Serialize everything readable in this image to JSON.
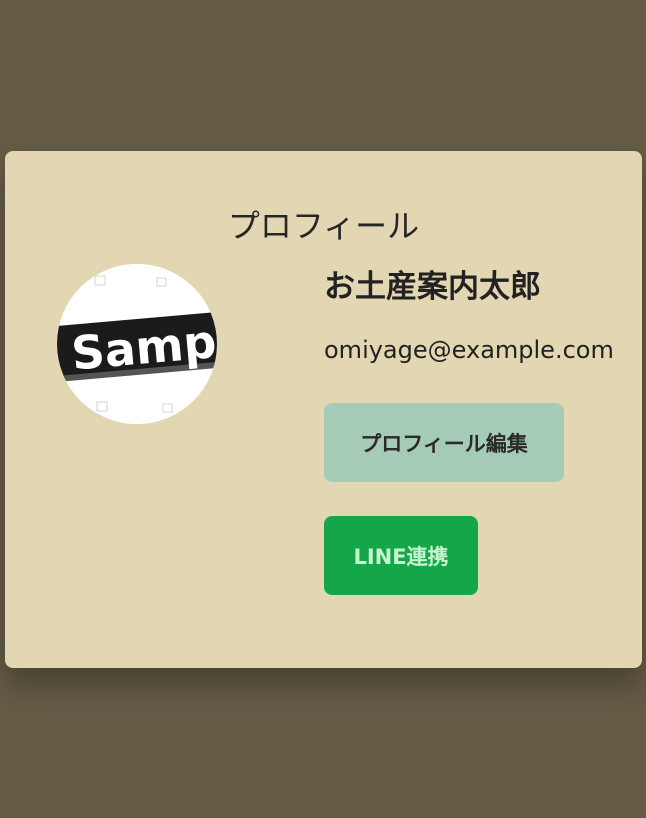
{
  "profile": {
    "heading": "プロフィール",
    "name": "お土産案内太郎",
    "email": "omiyage@example.com",
    "avatar_text": "Sample"
  },
  "actions": {
    "edit_label": "プロフィール編集",
    "line_label": "LINE連携"
  },
  "colors": {
    "backdrop": "#655c46",
    "card": "#e3d7b3",
    "edit_button": "#a5cbb6",
    "line_button": "#15a64a"
  }
}
